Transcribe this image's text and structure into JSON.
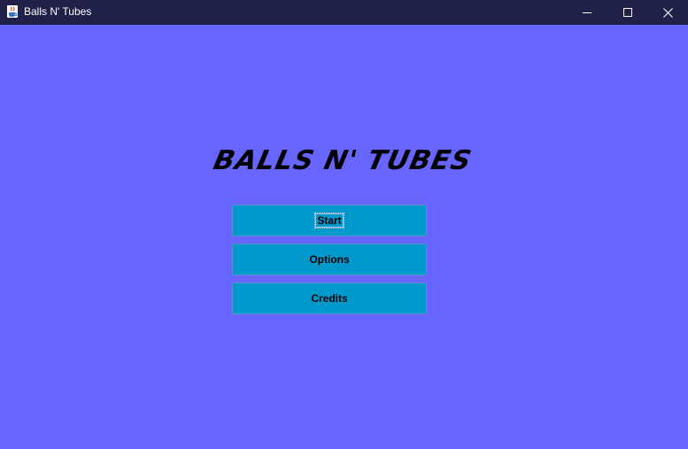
{
  "window": {
    "title": "Balls N' Tubes",
    "icon": "java-coffee-cup-icon",
    "controls": {
      "minimize_icon": "minimize-icon",
      "maximize_icon": "maximize-icon",
      "close_icon": "close-icon"
    }
  },
  "main_menu": {
    "game_title": "BALLS N' TUBES",
    "buttons": [
      {
        "label": "Start",
        "focused": true
      },
      {
        "label": "Options",
        "focused": false
      },
      {
        "label": "Credits",
        "focused": false
      }
    ]
  },
  "colors": {
    "background": "#6666ff",
    "titlebar": "#1f2148",
    "button": "#0099cc",
    "title_text": "#000000"
  }
}
